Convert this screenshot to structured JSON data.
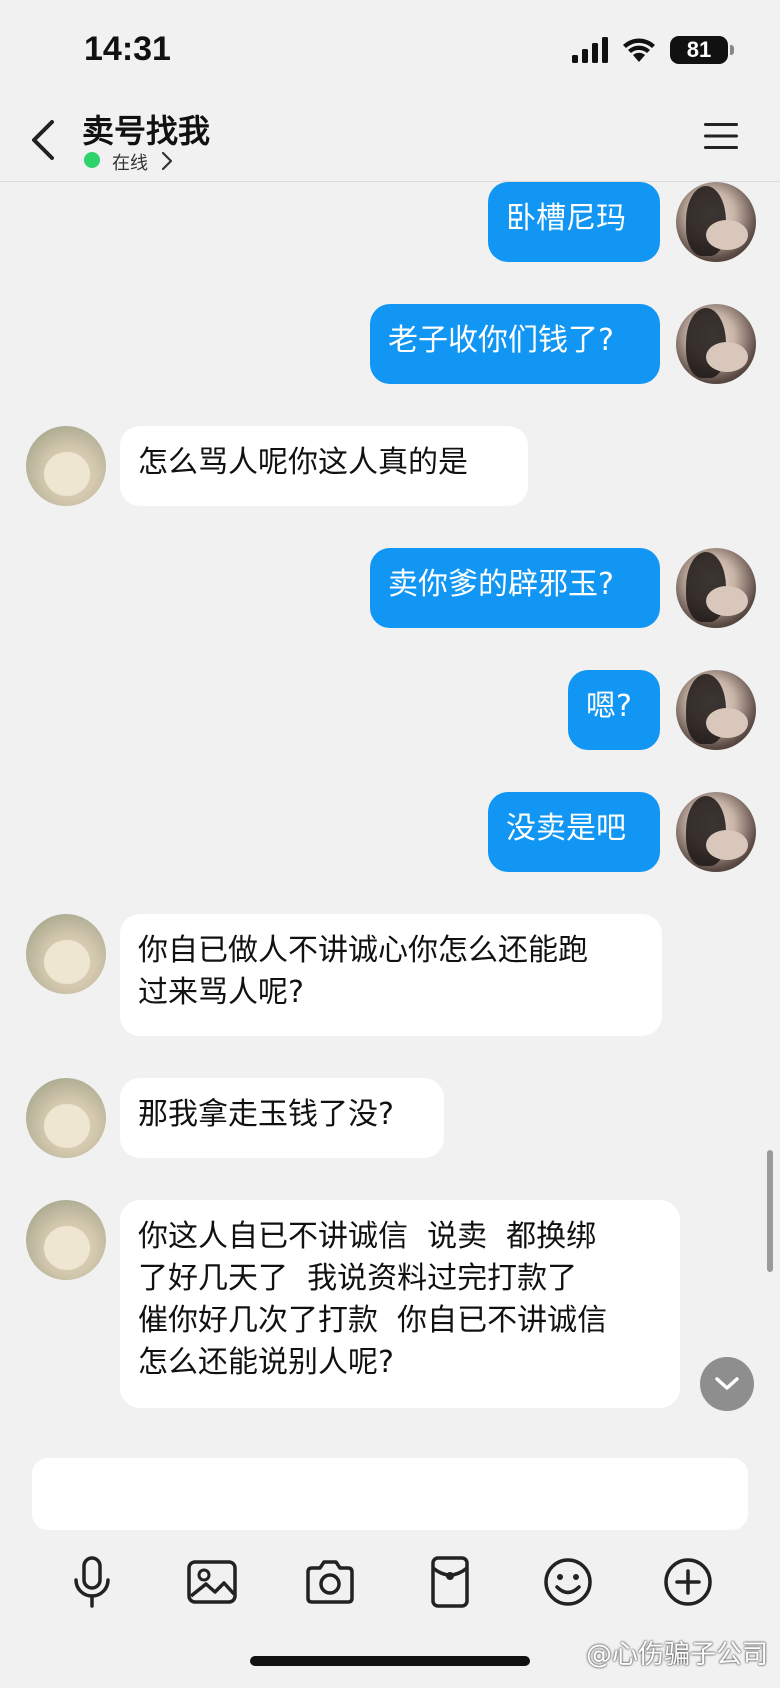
{
  "status_bar": {
    "time": "14:31",
    "battery": "81"
  },
  "header": {
    "title": "卖号找我",
    "status": "在线"
  },
  "messages": [
    {
      "sender": "me",
      "text": "卧槽尼玛"
    },
    {
      "sender": "me",
      "text": "老子收你们钱了?"
    },
    {
      "sender": "them",
      "text": "怎么骂人呢你这人真的是"
    },
    {
      "sender": "me",
      "text": "卖你爹的辟邪玉?"
    },
    {
      "sender": "me",
      "text": "嗯?"
    },
    {
      "sender": "me",
      "text": "没卖是吧"
    },
    {
      "sender": "them",
      "text": "你自已做人不讲诚心你怎么还能跑\n过来骂人呢?"
    },
    {
      "sender": "them",
      "text": "那我拿走玉钱了没?"
    },
    {
      "sender": "them",
      "text": "你这人自已不讲诚信  说卖  都换绑\n了好几天了  我说资料过完打款了\n催你好几次了打款  你自已不讲诚信\n怎么还能说别人呢?"
    }
  ],
  "input": {
    "placeholder": ""
  },
  "toolbar": [
    "microphone",
    "image",
    "camera",
    "red-packet",
    "emoji",
    "plus"
  ],
  "watermark": "@心伤骗子公司",
  "colors": {
    "my_bubble": "#1296f3",
    "their_bubble": "#ffffff",
    "online": "#2fd36b",
    "background": "#f1f1f1"
  }
}
